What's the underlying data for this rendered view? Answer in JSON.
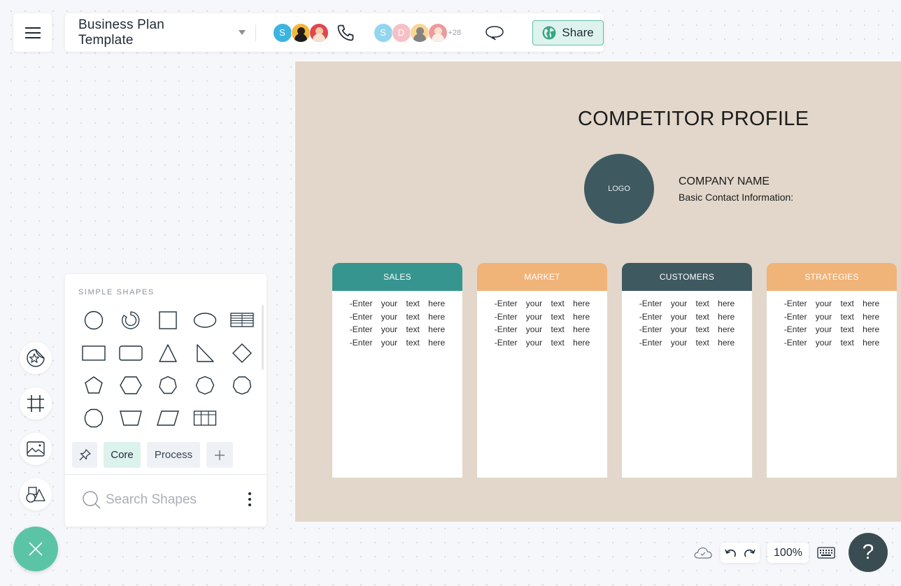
{
  "header": {
    "document_title": "Business Plan Template",
    "collaborators": [
      {
        "initial": "S",
        "color": "#3cb4e0",
        "type": "letter"
      },
      {
        "initial": "",
        "color": "#f3b63c",
        "type": "photo"
      },
      {
        "initial": "",
        "color": "#e0464f",
        "type": "photo"
      }
    ],
    "viewers": [
      {
        "initial": "S",
        "color": "#3cb4e0",
        "type": "letter"
      },
      {
        "initial": "D",
        "color": "#ef8f98",
        "type": "letter"
      },
      {
        "initial": "",
        "color": "#f3b63c",
        "type": "photo"
      },
      {
        "initial": "",
        "color": "#e0464f",
        "type": "photo"
      }
    ],
    "more_viewers": "+28",
    "share_label": "Share",
    "icons": [
      "menu-icon",
      "dropdown-caret-icon",
      "phone-icon",
      "comment-icon",
      "globe-icon"
    ]
  },
  "document": {
    "title": "COMPETITOR PROFILE",
    "logo_label": "LOGO",
    "company_name": "COMPANY NAME",
    "contact_label": "Basic Contact Information:",
    "columns": [
      {
        "title": "SALES",
        "color": "#36958f",
        "lines": [
          "-Enter your text here",
          "-Enter your text here",
          "-Enter your text here",
          "-Enter your text here"
        ]
      },
      {
        "title": "MARKET",
        "color": "#f0b378",
        "lines": [
          "-Enter your text here",
          "-Enter your text here",
          "-Enter your text here",
          "-Enter your text here"
        ]
      },
      {
        "title": "CUSTOMERS",
        "color": "#3f5961",
        "lines": [
          "-Enter your text here",
          "-Enter your text here",
          "-Enter your text here",
          "-Enter your text here"
        ]
      },
      {
        "title": "STRATEGIES",
        "color": "#f0b378",
        "lines": [
          "-Enter your text here",
          "-Enter your text here",
          "-Enter your text here",
          "-Enter your text here"
        ]
      }
    ]
  },
  "shapes_panel": {
    "section_title": "SIMPLE SHAPES",
    "shapes": [
      "circle",
      "arc",
      "square",
      "ellipse",
      "table-lines",
      "rectangle",
      "rounded-rectangle",
      "triangle",
      "right-triangle",
      "diamond",
      "pentagon",
      "hexagon",
      "heptagon",
      "octagon",
      "nonagon",
      "decagon",
      "trapezoid",
      "parallelogram",
      "grid-table"
    ],
    "tabs": [
      {
        "label": "",
        "icon": "pin-icon"
      },
      {
        "label": "Core",
        "active": true
      },
      {
        "label": "Process"
      },
      {
        "label": "",
        "icon": "plus-icon"
      }
    ],
    "search_placeholder": "Search Shapes"
  },
  "tool_rail": [
    "sticker-icon",
    "frame-icon",
    "image-icon",
    "shapes-icon"
  ],
  "footer": {
    "zoom_level": "100%",
    "help_label": "?"
  },
  "colors": {
    "accent": "#5cc4a6",
    "canvas_bg": "#e2d7ca",
    "dark": "#394c52"
  }
}
